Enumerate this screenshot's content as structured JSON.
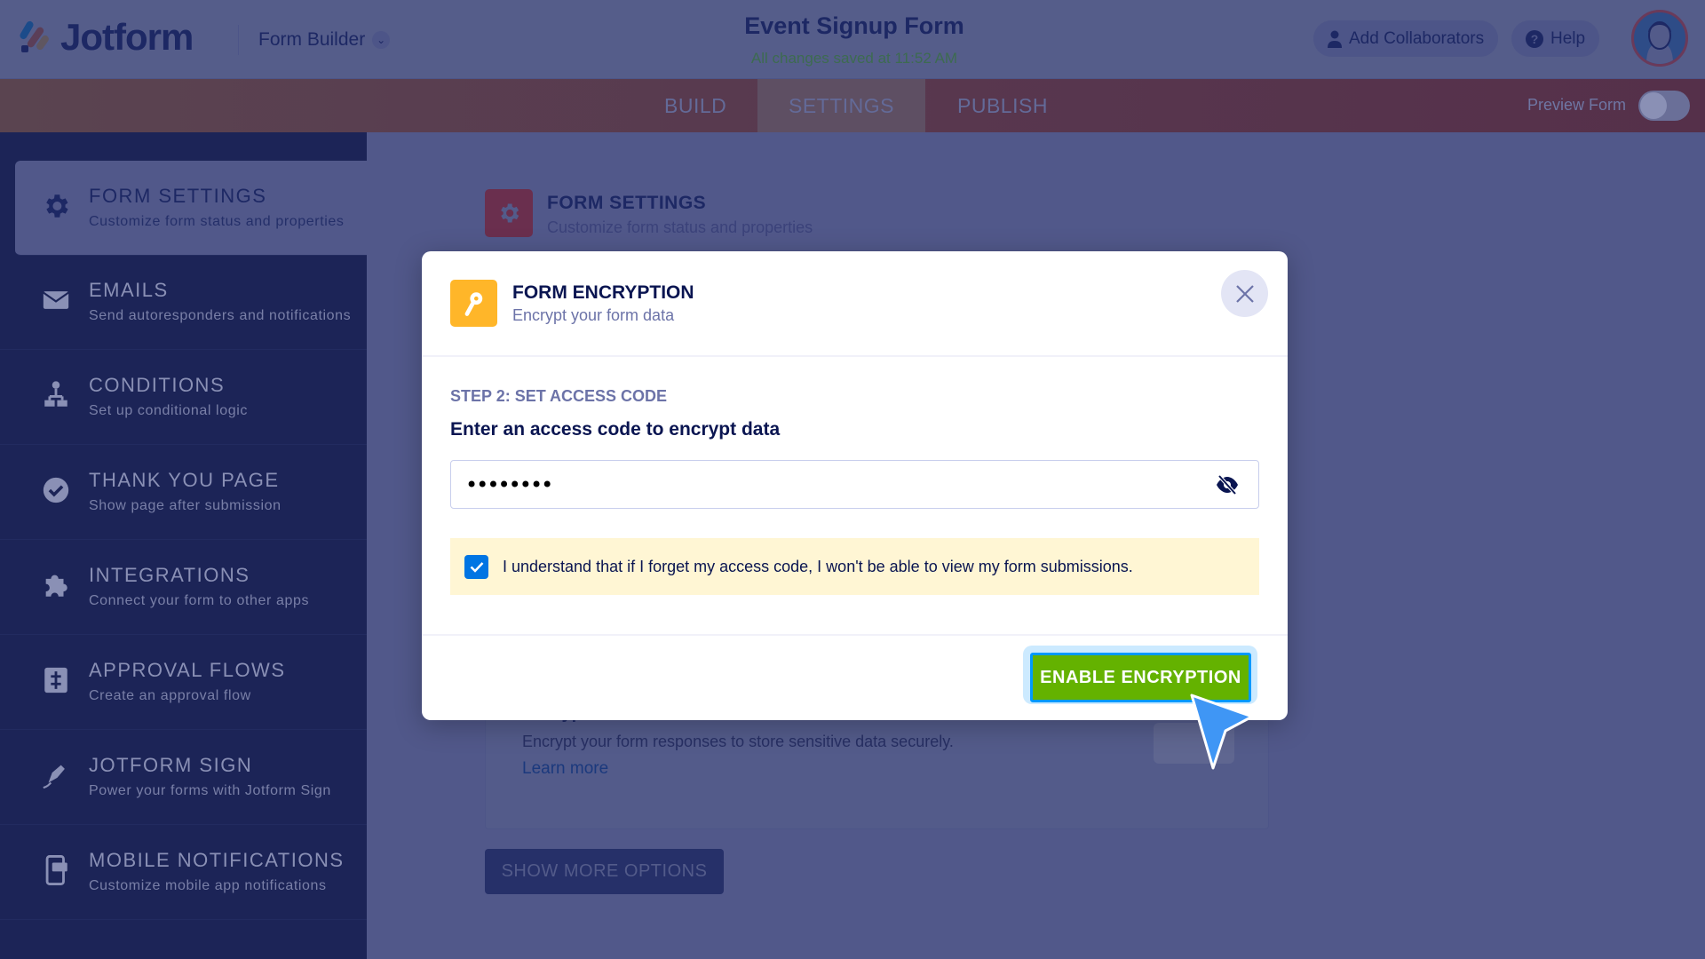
{
  "header": {
    "brand": "Jotform",
    "builder_label": "Form Builder",
    "form_title": "Event Signup Form",
    "save_status": "All changes saved at 11:52 AM",
    "add_collaborators": "Add Collaborators",
    "help": "Help"
  },
  "tabs": {
    "build": "BUILD",
    "settings": "SETTINGS",
    "publish": "PUBLISH",
    "active": "SETTINGS",
    "preview_form": "Preview Form",
    "preview_enabled": false
  },
  "sidebar": {
    "items": [
      {
        "title": "FORM SETTINGS",
        "subtitle": "Customize form status and properties",
        "icon": "gear-icon",
        "active": true
      },
      {
        "title": "EMAILS",
        "subtitle": "Send autoresponders and notifications",
        "icon": "envelope-icon"
      },
      {
        "title": "CONDITIONS",
        "subtitle": "Set up conditional logic",
        "icon": "flow-icon"
      },
      {
        "title": "THANK YOU PAGE",
        "subtitle": "Show page after submission",
        "icon": "check-circle-icon"
      },
      {
        "title": "INTEGRATIONS",
        "subtitle": "Connect your form to other apps",
        "icon": "puzzle-icon"
      },
      {
        "title": "APPROVAL FLOWS",
        "subtitle": "Create an approval flow",
        "icon": "approval-icon"
      },
      {
        "title": "JOTFORM SIGN",
        "subtitle": "Power your forms with Jotform Sign",
        "icon": "pen-icon"
      },
      {
        "title": "MOBILE NOTIFICATIONS",
        "subtitle": "Customize mobile app notifications",
        "icon": "mobile-icon"
      }
    ]
  },
  "main": {
    "title": "FORM SETTINGS",
    "subtitle": "Customize form status and properties",
    "card_title": "Encrypt Form Data",
    "card_desc": "Encrypt your form responses to store sensitive data securely.",
    "learn_more": "Learn more",
    "show_more": "SHOW MORE OPTIONS"
  },
  "modal": {
    "title": "FORM ENCRYPTION",
    "subtitle": "Encrypt your form data",
    "step": "STEP 2: SET ACCESS CODE",
    "label": "Enter an access code to encrypt data",
    "access_code_value": "••••••••",
    "acknowledge": "I understand that if I forget my access code, I won't be able to view my form submissions.",
    "acknowledge_checked": true,
    "enable_button": "ENABLE ENCRYPTION"
  },
  "colors": {
    "accent_green": "#64b200",
    "key_icon": "#ffb629",
    "checkbox": "#0075e3",
    "navy": "#0a1551"
  }
}
